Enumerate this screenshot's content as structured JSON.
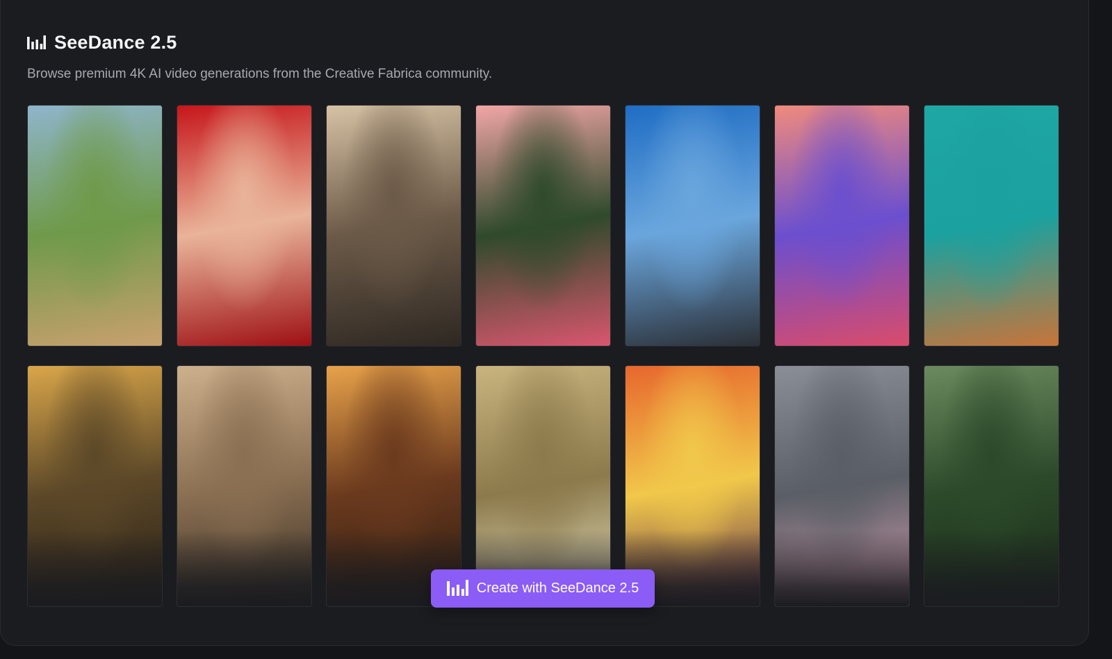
{
  "header": {
    "icon": "bar-chart-icon",
    "title": "SeeDance 2.5",
    "subtitle": "Browse premium 4K AI video generations from the Creative Fabrica community."
  },
  "gallery": {
    "items": [
      {
        "icon": "image-thumbnail",
        "colors": [
          "#8fb5cc",
          "#6f9a4a",
          "#c9a06e"
        ]
      },
      {
        "icon": "image-thumbnail",
        "colors": [
          "#c6161b",
          "#e9b499",
          "#9e1014"
        ]
      },
      {
        "icon": "image-thumbnail",
        "colors": [
          "#d6c2a4",
          "#6c5a48",
          "#2e2822"
        ]
      },
      {
        "icon": "image-thumbnail",
        "colors": [
          "#f2a6a6",
          "#2f4a2b",
          "#d9566e"
        ]
      },
      {
        "icon": "image-thumbnail",
        "colors": [
          "#1f6dc4",
          "#6aa6dd",
          "#2b2f36"
        ]
      },
      {
        "icon": "image-thumbnail",
        "colors": [
          "#f08a7c",
          "#6b4fcf",
          "#d94b6b"
        ]
      },
      {
        "icon": "image-thumbnail",
        "colors": [
          "#1ea7a5",
          "#1ba19f",
          "#c8743a"
        ]
      },
      {
        "icon": "image-thumbnail",
        "colors": [
          "#d9a64a",
          "#5c4828",
          "#2a2016"
        ]
      },
      {
        "icon": "image-thumbnail",
        "colors": [
          "#cdb08c",
          "#8a6f52",
          "#3b3024"
        ]
      },
      {
        "icon": "image-thumbnail",
        "colors": [
          "#e8a24a",
          "#6b3a1e",
          "#2a1a10"
        ]
      },
      {
        "icon": "image-thumbnail",
        "colors": [
          "#c9b47e",
          "#8c7a4c",
          "#e9e3c2"
        ]
      },
      {
        "icon": "image-thumbnail",
        "colors": [
          "#e7672e",
          "#f1c84a",
          "#5a2b4e"
        ]
      },
      {
        "icon": "image-thumbnail",
        "colors": [
          "#8a8e96",
          "#5a5e66",
          "#d3a0b0"
        ]
      },
      {
        "icon": "image-thumbnail",
        "colors": [
          "#6c8a5e",
          "#2c4a2a",
          "#1a2a18"
        ]
      }
    ]
  },
  "cta": {
    "icon": "bar-chart-icon",
    "label": "Create with SeeDance 2.5",
    "color": "#8b5cf6"
  }
}
